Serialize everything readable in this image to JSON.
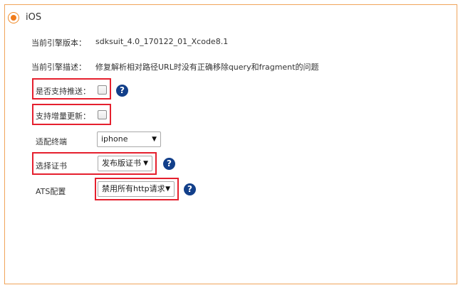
{
  "platform": {
    "label": "iOS",
    "selected": true
  },
  "engine_version": {
    "label": "当前引擎版本：",
    "value": "sdksuit_4.0_170122_01_Xcode8.1"
  },
  "engine_desc": {
    "label": "当前引擎描述：",
    "value": "修复解析相对路径URL时没有正确移除query和fragment的问题"
  },
  "push_support": {
    "label": "是否支持推送：",
    "checked": false
  },
  "incremental_update": {
    "label": "支持增量更新：",
    "checked": false
  },
  "terminal": {
    "label": "适配终端",
    "selected": "iphone"
  },
  "certificate": {
    "label": "选择证书",
    "selected": "发布版证书"
  },
  "ats": {
    "label": "ATS配置",
    "selected": "禁用所有http请求"
  },
  "help_icon": "?",
  "dropdown_arrow": "▼",
  "colors": {
    "panel_border": "#f0a45a",
    "radio": "#f07b1a",
    "highlight": "#e5202e",
    "help": "#123f8a"
  }
}
